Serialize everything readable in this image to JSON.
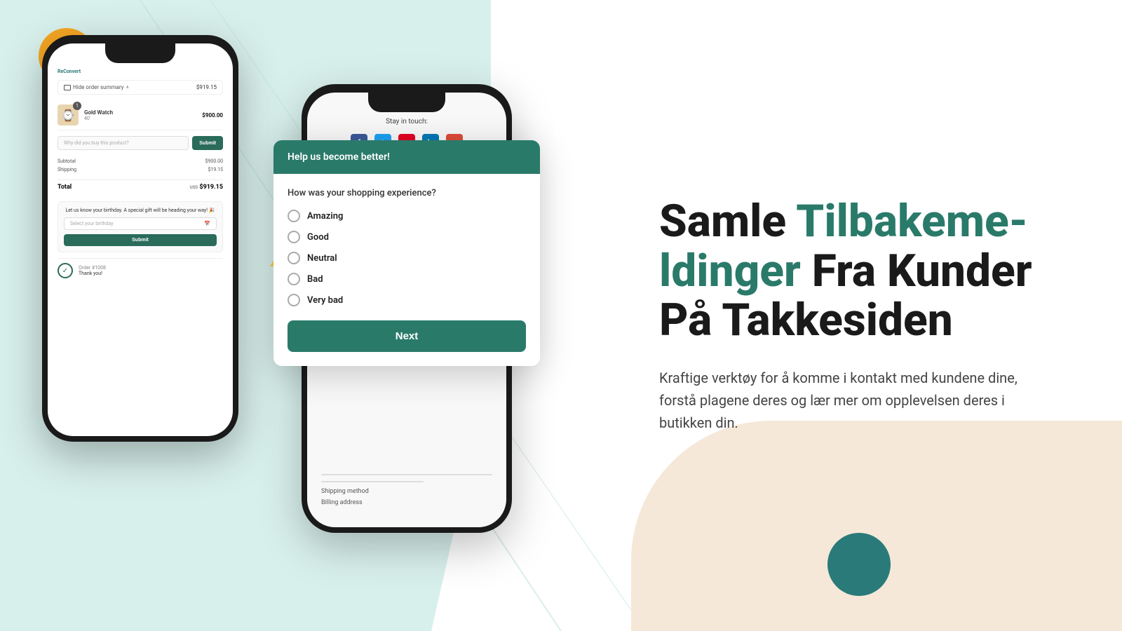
{
  "background": {
    "left_color": "#d8f0ec",
    "right_color": "#ffffff",
    "cream_color": "#f5e8d8"
  },
  "phone_left": {
    "reconvert_label": "ReConvert",
    "order_summary_label": "Hide order summary",
    "order_total": "$919.15",
    "product_name": "Gold Watch",
    "product_variant": "40'",
    "product_price": "$900.00",
    "subtotal_label": "Subtotal",
    "subtotal_value": "$900.00",
    "shipping_label": "Shipping",
    "shipping_value": "$19.15",
    "total_label": "Total",
    "total_currency": "USD",
    "total_value": "$919.15",
    "birthday_text": "Let us know your birthday. A special gift will be heading your way! 🎉",
    "birthday_placeholder": "Select your birthday",
    "birthday_submit_label": "Submit",
    "order_number": "Order #1008",
    "thank_you_text": "Thank you!",
    "survey_placeholder": "Why did you buy this product?",
    "survey_submit_label": "Submit"
  },
  "phone_center": {
    "stay_in_touch_label": "Stay in touch:",
    "shipping_method_label": "Shipping method",
    "billing_label": "Billing address"
  },
  "survey": {
    "header": "Help us become better!",
    "question": "How was your shopping experience?",
    "options": [
      {
        "label": "Amazing",
        "value": "amazing"
      },
      {
        "label": "Good",
        "value": "good"
      },
      {
        "label": "Neutral",
        "value": "neutral"
      },
      {
        "label": "Bad",
        "value": "bad"
      },
      {
        "label": "Very bad",
        "value": "very_bad"
      }
    ],
    "next_button_label": "Next"
  },
  "headline": {
    "part1": "Samle ",
    "part2_teal": "Tilbakeme-\nldinger",
    "part3": " Fra Kunder\nPå Takkesiden"
  },
  "subtext": "Kraftige verktøy for å komme i kontakt med kundene dine, forstå plagene deres og lær mer om opplevelsen deres i butikken din.",
  "colors": {
    "teal_dark": "#2a7a6a",
    "teal_medium": "#2a9a8a",
    "orange": "#f5a623",
    "yellow": "#f5c842",
    "cream": "#f5e8d8"
  }
}
